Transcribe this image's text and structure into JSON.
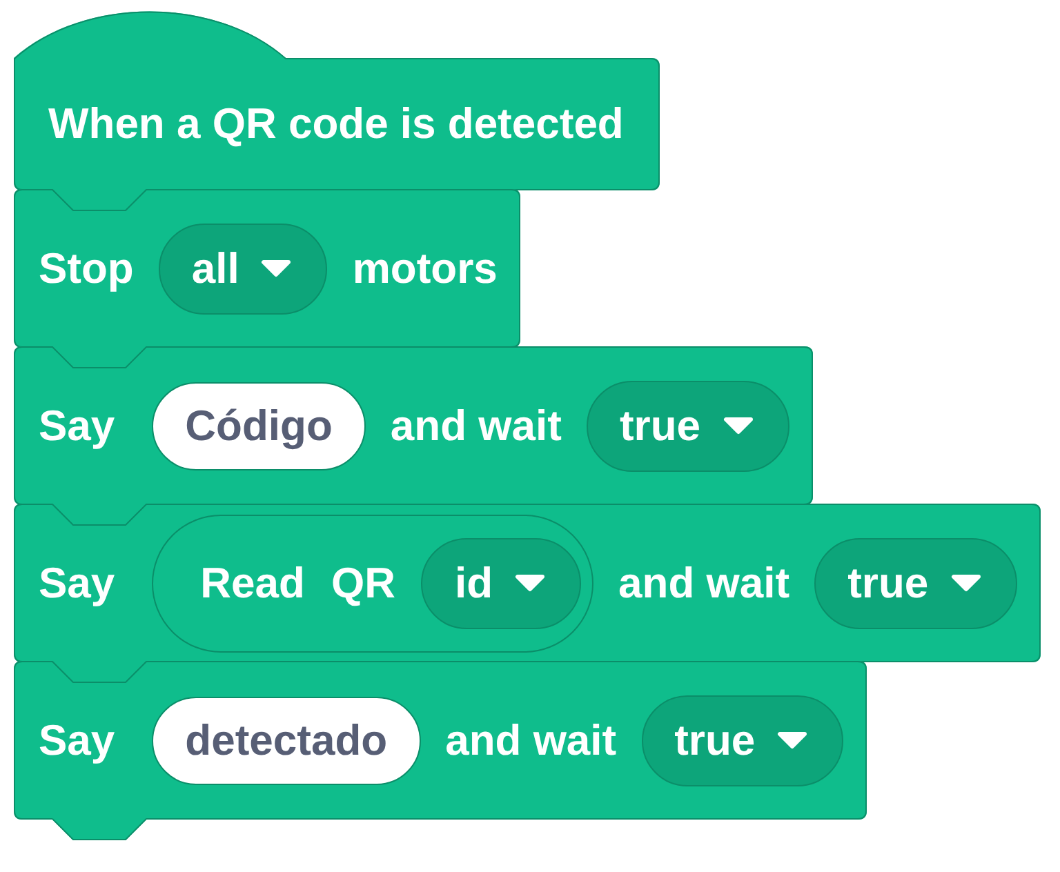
{
  "script": [
    {
      "kind": "hat",
      "parts": [
        {
          "kind": "label",
          "text": "When a QR code is detected"
        }
      ]
    },
    {
      "kind": "stack",
      "parts": [
        {
          "kind": "label",
          "text": "Stop"
        },
        {
          "kind": "dropdown",
          "text": "all"
        },
        {
          "kind": "label",
          "text": "motors"
        }
      ]
    },
    {
      "kind": "stack",
      "parts": [
        {
          "kind": "label",
          "text": "Say"
        },
        {
          "kind": "text_input",
          "text": "Código"
        },
        {
          "kind": "label",
          "text": "and wait"
        },
        {
          "kind": "dropdown",
          "text": "true"
        }
      ]
    },
    {
      "kind": "stack",
      "parts": [
        {
          "kind": "label",
          "text": "Say"
        },
        {
          "kind": "reporter",
          "parts": [
            {
              "kind": "label",
              "text": "Read"
            },
            {
              "kind": "label",
              "text": "QR"
            },
            {
              "kind": "dropdown",
              "text": "id"
            }
          ]
        },
        {
          "kind": "label",
          "text": "and wait"
        },
        {
          "kind": "dropdown",
          "text": "true"
        }
      ]
    },
    {
      "kind": "stack",
      "parts": [
        {
          "kind": "label",
          "text": "Say"
        },
        {
          "kind": "text_input",
          "text": "detectado"
        },
        {
          "kind": "label",
          "text": "and wait"
        },
        {
          "kind": "dropdown",
          "text": "true"
        }
      ]
    }
  ]
}
